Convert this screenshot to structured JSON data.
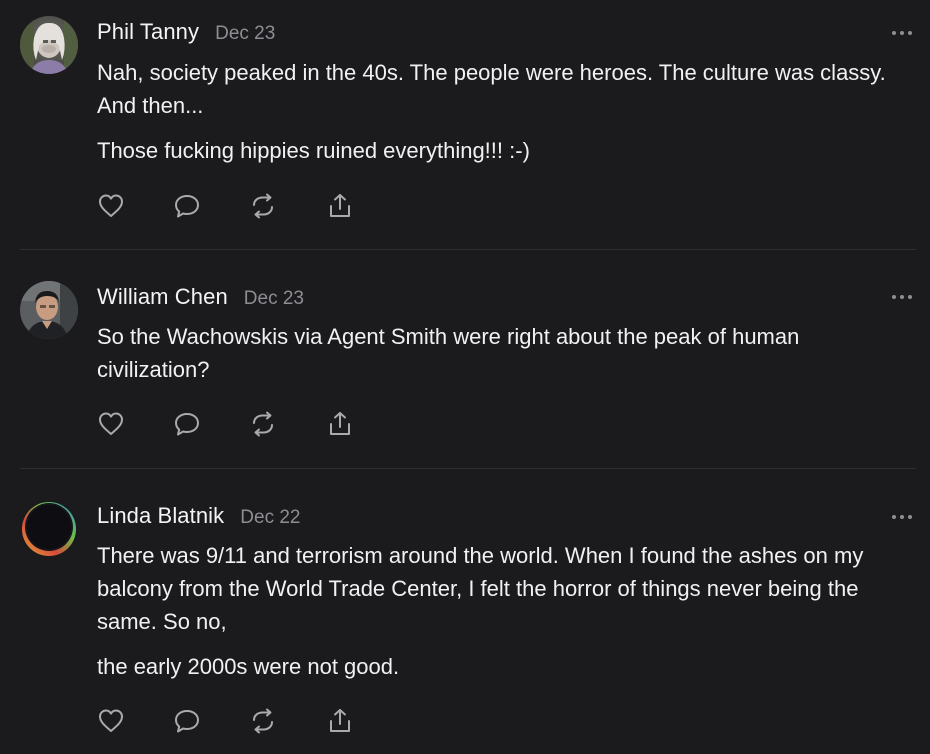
{
  "comments": [
    {
      "author": "Phil Tanny",
      "date": "Dec 23",
      "paragraphs": [
        "Nah, society peaked in the 40s. The people were heroes. The culture was classy. And then...",
        "Those fucking hippies ruined everything!!! :-)"
      ],
      "avatar": "avatar-phil-tanny",
      "actions": [
        "heart-icon",
        "comment-icon",
        "restack-icon",
        "share-icon"
      ]
    },
    {
      "author": "William Chen",
      "date": "Dec 23",
      "paragraphs": [
        "So the Wachowskis via Agent Smith were right about the peak of human civilization?"
      ],
      "avatar": "avatar-william-chen",
      "actions": [
        "heart-icon",
        "comment-icon",
        "restack-icon",
        "share-icon"
      ]
    },
    {
      "author": "Linda Blatnik",
      "date": "Dec 22",
      "paragraphs": [
        "There was 9/11 and terrorism around the world. When I found the ashes on my balcony from the World Trade Center, I felt the horror of things never being the same. So no,",
        "the early 2000s were not good."
      ],
      "avatar": "avatar-linda-blatnik",
      "actions": [
        "heart-icon",
        "comment-icon",
        "restack-icon",
        "share-icon"
      ]
    }
  ],
  "colors": {
    "background": "#1b1b1d",
    "text": "#f1f1f3",
    "muted": "#8d8d93",
    "icon": "#a9a9ae",
    "divider": "#2f2f33"
  }
}
